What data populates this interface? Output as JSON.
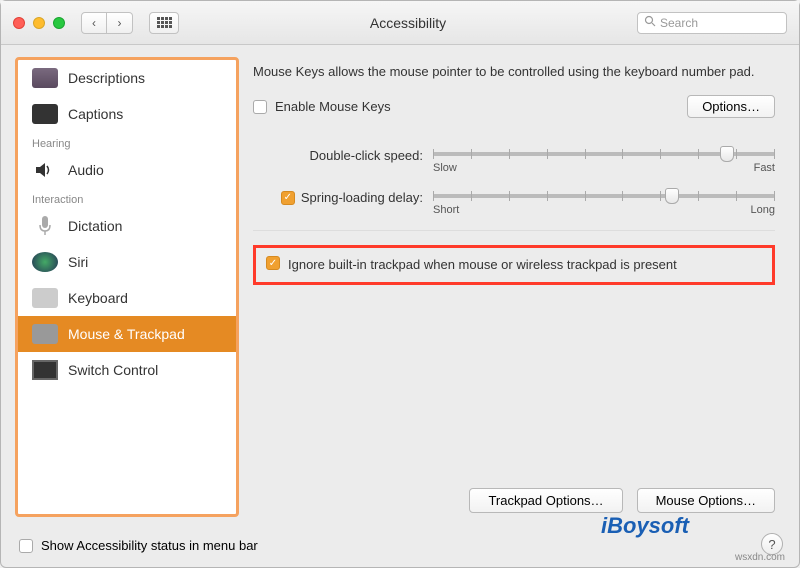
{
  "window": {
    "title": "Accessibility"
  },
  "search": {
    "placeholder": "Search"
  },
  "sidebar": {
    "items": [
      {
        "label": "Descriptions"
      },
      {
        "label": "Captions"
      }
    ],
    "hearing_header": "Hearing",
    "hearing": [
      {
        "label": "Audio"
      }
    ],
    "interaction_header": "Interaction",
    "interaction": [
      {
        "label": "Dictation"
      },
      {
        "label": "Siri"
      },
      {
        "label": "Keyboard"
      },
      {
        "label": "Mouse & Trackpad"
      },
      {
        "label": "Switch Control"
      }
    ]
  },
  "main": {
    "description": "Mouse Keys allows the mouse pointer to be controlled using the keyboard number pad.",
    "enable_label": "Enable Mouse Keys",
    "options_btn": "Options…",
    "slider1": {
      "label": "Double-click speed:",
      "min": "Slow",
      "max": "Fast",
      "value_pct": 86
    },
    "slider2": {
      "label": "Spring-loading delay:",
      "min": "Short",
      "max": "Long",
      "value_pct": 70,
      "checked": true
    },
    "ignore_label": "Ignore built-in trackpad when mouse or wireless trackpad is present",
    "trackpad_btn": "Trackpad Options…",
    "mouse_btn": "Mouse Options…"
  },
  "footer": {
    "label": "Show Accessibility status in menu bar"
  },
  "watermark": {
    "brand": "iBoysoft",
    "site": "wsxdn.com"
  }
}
